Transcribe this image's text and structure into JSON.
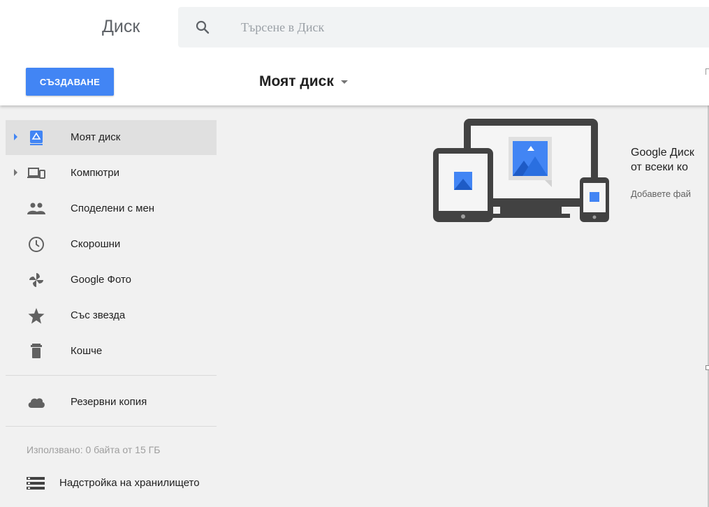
{
  "header": {
    "app_title": "Диск",
    "search": {
      "placeholder": "Търсене в Диск",
      "value": "",
      "icon": "search-icon"
    },
    "create_button_label": "СЪЗДАВАНЕ",
    "location_label": "Моят диск"
  },
  "sidebar": {
    "items": [
      {
        "label": "Моят диск",
        "icon": "drive-icon",
        "expandable": true,
        "active": true
      },
      {
        "label": "Компютри",
        "icon": "computers-icon",
        "expandable": true,
        "active": false
      },
      {
        "label": "Споделени с мен",
        "icon": "people-icon",
        "expandable": false,
        "active": false
      },
      {
        "label": "Скорошни",
        "icon": "clock-icon",
        "expandable": false,
        "active": false
      },
      {
        "label": "Google Фото",
        "icon": "photos-pinwheel-icon",
        "expandable": false,
        "active": false
      },
      {
        "label": "Със звезда",
        "icon": "star-icon",
        "expandable": false,
        "active": false
      },
      {
        "label": "Кошче",
        "icon": "trash-icon",
        "expandable": false,
        "active": false
      },
      {
        "label": "Резервни копия",
        "icon": "cloud-icon",
        "expandable": false,
        "active": false
      }
    ],
    "storage_used": "Използвано: 0 байта от 15 ГБ",
    "storage_settings_label": "Надстройка на хранилището"
  },
  "main": {
    "promo_title_line1": "Google Диск",
    "promo_title_line2": "от всеки ко",
    "promo_subtitle": "Добавете фай"
  },
  "colors": {
    "accent": "#4285f4",
    "active_item_bg": "#e0e0e0",
    "background": "#f1f1f1",
    "device_frame": "#424242"
  }
}
